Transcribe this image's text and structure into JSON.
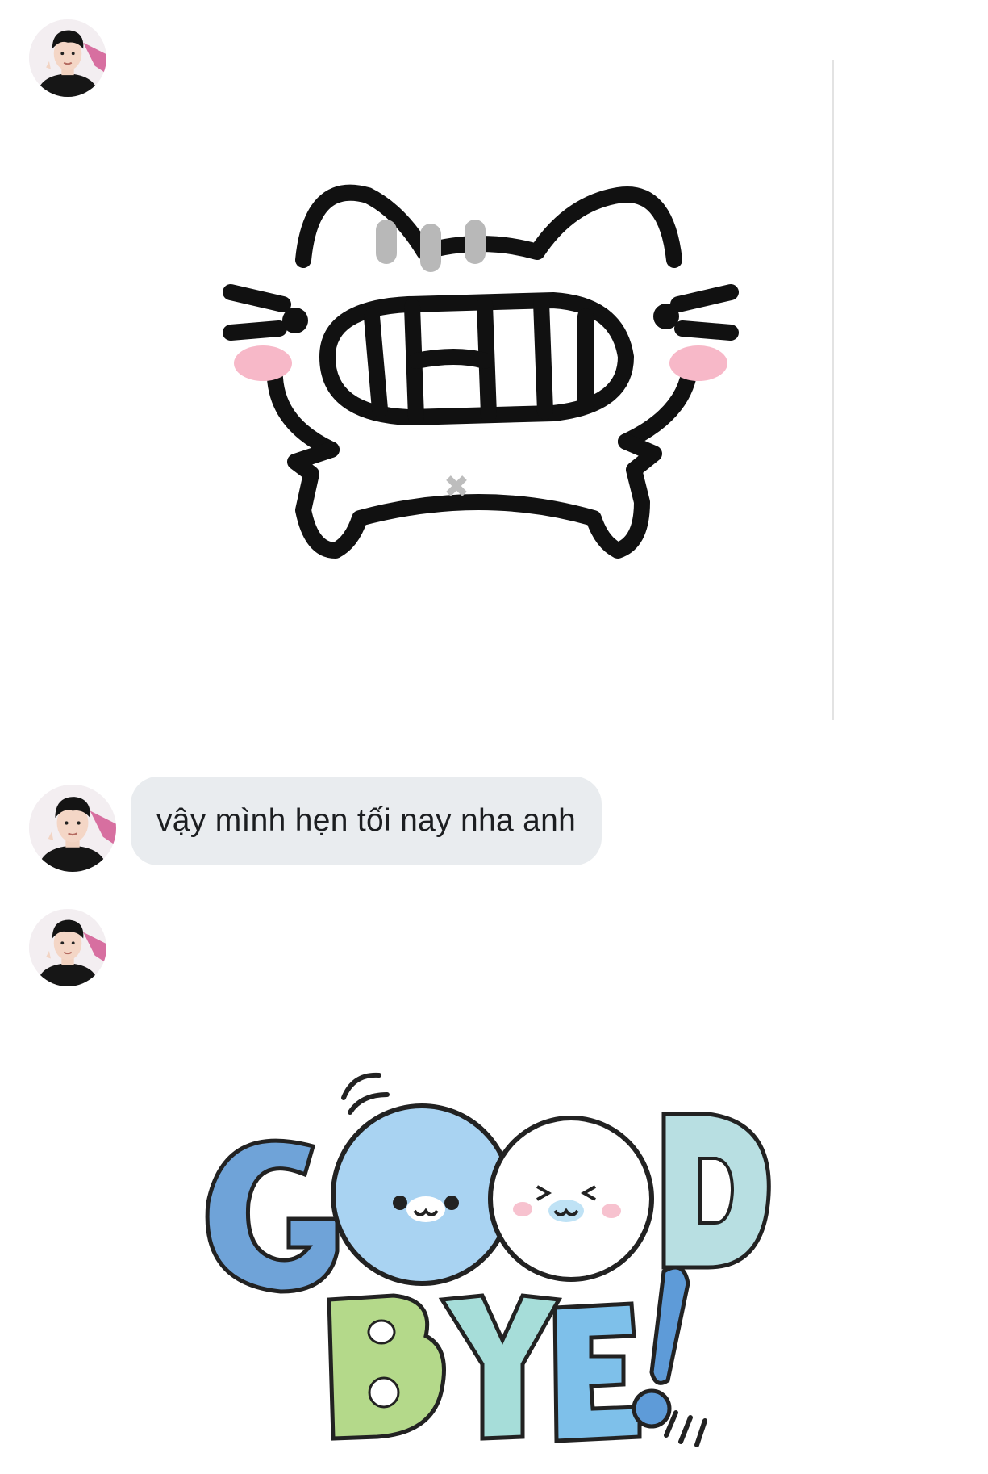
{
  "conversation": {
    "messages": [
      {
        "type": "sticker",
        "sticker_name": "grinning-cat-sticker"
      },
      {
        "type": "text",
        "text": "vậy mình hẹn tối nay nha anh"
      },
      {
        "type": "sticker",
        "sticker_name": "goodbye-seals-sticker",
        "sticker_text": "GOOD BYE!"
      }
    ]
  },
  "colors": {
    "bubble_background": "#e9ecef",
    "bubble_text": "#1c1e21",
    "background": "#ffffff"
  }
}
